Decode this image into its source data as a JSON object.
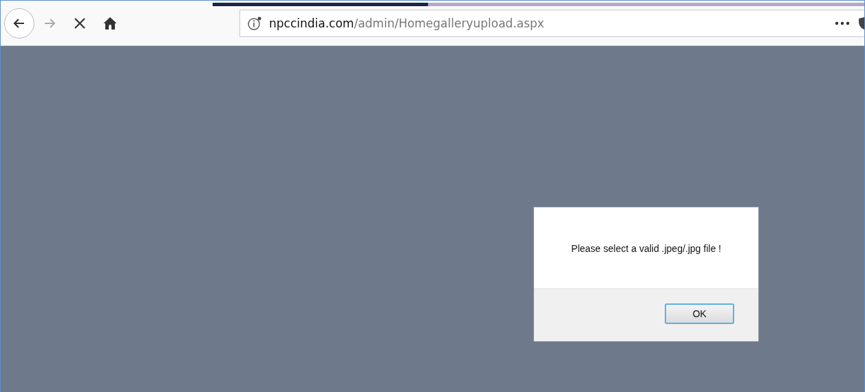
{
  "toolbar": {
    "back": {
      "disabled": false
    },
    "forward": {
      "disabled": true
    },
    "loading": {
      "level": 0.33
    },
    "address": {
      "host": "npccindia.com",
      "path": "/admin/Homegalleryupload.aspx"
    }
  },
  "dialog": {
    "message": "Please select a valid .jpeg/.jpg file !",
    "buttons": [
      "OK"
    ]
  }
}
